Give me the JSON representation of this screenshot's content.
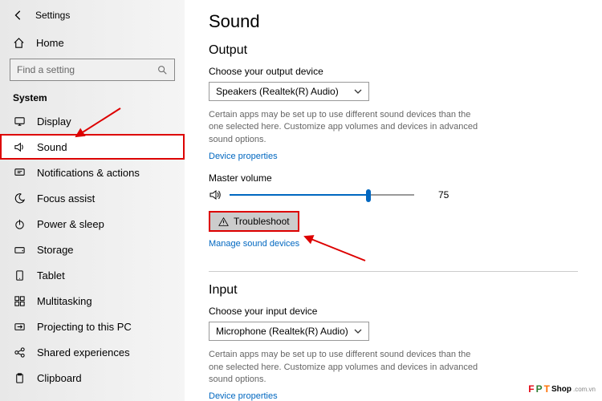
{
  "header": {
    "settings": "Settings",
    "home": "Home"
  },
  "search": {
    "placeholder": "Find a setting"
  },
  "section": "System",
  "nav": [
    {
      "label": "Display",
      "icon": "display"
    },
    {
      "label": "Sound",
      "icon": "sound",
      "selected": true
    },
    {
      "label": "Notifications & actions",
      "icon": "bell"
    },
    {
      "label": "Focus assist",
      "icon": "moon"
    },
    {
      "label": "Power & sleep",
      "icon": "power"
    },
    {
      "label": "Storage",
      "icon": "drive"
    },
    {
      "label": "Tablet",
      "icon": "tablet"
    },
    {
      "label": "Multitasking",
      "icon": "multi"
    },
    {
      "label": "Projecting to this PC",
      "icon": "project"
    },
    {
      "label": "Shared experiences",
      "icon": "share"
    },
    {
      "label": "Clipboard",
      "icon": "clip"
    }
  ],
  "main": {
    "title": "Sound",
    "output": {
      "heading": "Output",
      "choose": "Choose your output device",
      "device": "Speakers (Realtek(R) Audio)",
      "desc": "Certain apps may be set up to use different sound devices than the one selected here. Customize app volumes and devices in advanced sound options.",
      "device_props": "Device properties",
      "master": "Master volume",
      "volume": "75",
      "troubleshoot": "Troubleshoot",
      "manage": "Manage sound devices"
    },
    "input": {
      "heading": "Input",
      "choose": "Choose your input device",
      "device": "Microphone (Realtek(R) Audio)",
      "desc": "Certain apps may be set up to use different sound devices than the one selected here. Customize app volumes and devices in advanced sound options.",
      "device_props": "Device properties"
    }
  },
  "watermark": {
    "brand_f": "F",
    "brand_p": "P",
    "brand_t": "T",
    "shop": "Shop",
    "domain": ".com.vn"
  }
}
